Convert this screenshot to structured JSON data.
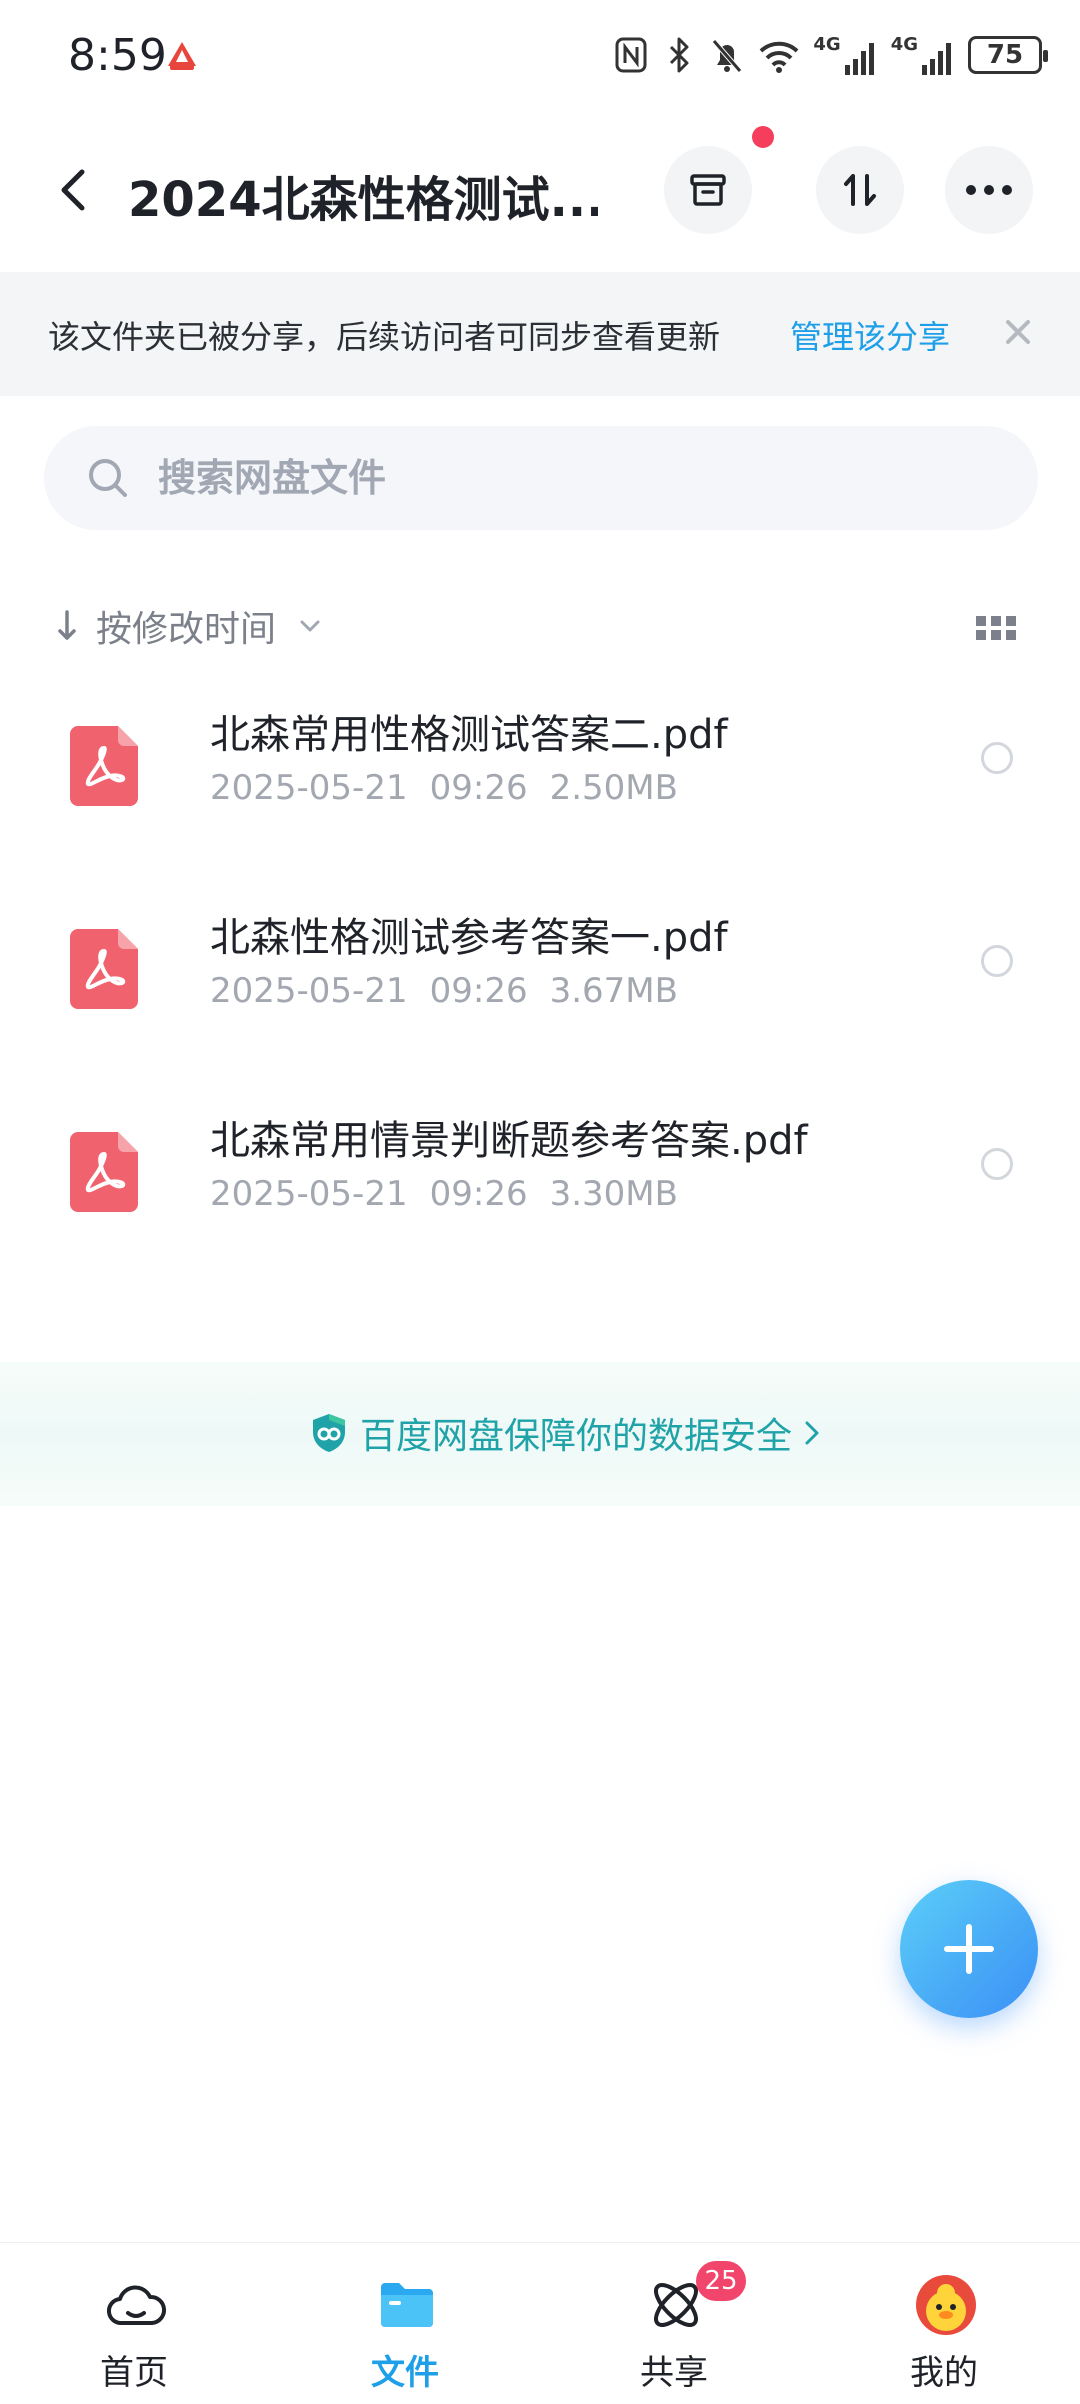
{
  "status_bar": {
    "time": "8:59",
    "network_1": "4G",
    "network_2": "4G",
    "battery": "75"
  },
  "header": {
    "title": "2024北森性格测试...",
    "icons": [
      "back-icon",
      "archive-icon",
      "transfer-icon",
      "more-icon"
    ]
  },
  "share_banner": {
    "text": "该文件夹已被分享，后续访问者可同步查看更新",
    "manage_label": "管理该分享"
  },
  "search": {
    "placeholder": "搜索网盘文件"
  },
  "sort": {
    "label": "按修改时间"
  },
  "files": [
    {
      "name": "北森常用性格测试答案二.pdf",
      "date": "2025-05-21",
      "time": "09:26",
      "size": "2.50MB"
    },
    {
      "name": "北森性格测试参考答案一.pdf",
      "date": "2025-05-21",
      "time": "09:26",
      "size": "3.67MB"
    },
    {
      "name": "北森常用情景判断题参考答案.pdf",
      "date": "2025-05-21",
      "time": "09:26",
      "size": "3.30MB"
    }
  ],
  "security_banner": {
    "text": "百度网盘保障你的数据安全"
  },
  "bottom_nav": {
    "items": [
      {
        "label": "首页",
        "icon": "cloud-home-icon",
        "active": false
      },
      {
        "label": "文件",
        "icon": "folder-icon",
        "active": true
      },
      {
        "label": "共享",
        "icon": "share-orbit-icon",
        "active": false,
        "badge": "25"
      },
      {
        "label": "我的",
        "icon": "avatar-duck-icon",
        "active": false
      }
    ]
  },
  "colors": {
    "accent": "#1e9fe8",
    "pdf_red": "#f0636e",
    "badge_red": "#f2456b",
    "security_teal": "#1fa3a8"
  }
}
